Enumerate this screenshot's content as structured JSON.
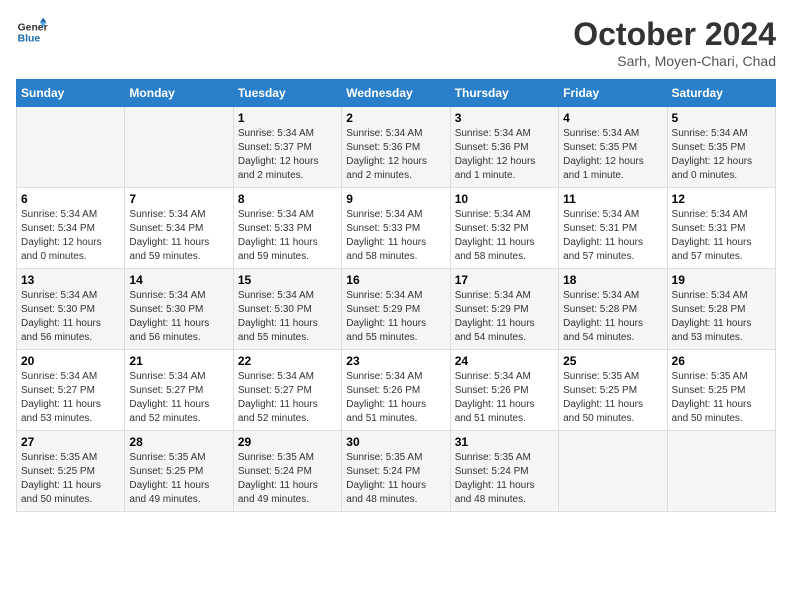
{
  "logo": {
    "line1": "General",
    "line2": "Blue"
  },
  "title": "October 2024",
  "location": "Sarh, Moyen-Chari, Chad",
  "headers": [
    "Sunday",
    "Monday",
    "Tuesday",
    "Wednesday",
    "Thursday",
    "Friday",
    "Saturday"
  ],
  "weeks": [
    [
      {
        "day": "",
        "info": ""
      },
      {
        "day": "",
        "info": ""
      },
      {
        "day": "1",
        "info": "Sunrise: 5:34 AM\nSunset: 5:37 PM\nDaylight: 12 hours\nand 2 minutes."
      },
      {
        "day": "2",
        "info": "Sunrise: 5:34 AM\nSunset: 5:36 PM\nDaylight: 12 hours\nand 2 minutes."
      },
      {
        "day": "3",
        "info": "Sunrise: 5:34 AM\nSunset: 5:36 PM\nDaylight: 12 hours\nand 1 minute."
      },
      {
        "day": "4",
        "info": "Sunrise: 5:34 AM\nSunset: 5:35 PM\nDaylight: 12 hours\nand 1 minute."
      },
      {
        "day": "5",
        "info": "Sunrise: 5:34 AM\nSunset: 5:35 PM\nDaylight: 12 hours\nand 0 minutes."
      }
    ],
    [
      {
        "day": "6",
        "info": "Sunrise: 5:34 AM\nSunset: 5:34 PM\nDaylight: 12 hours\nand 0 minutes."
      },
      {
        "day": "7",
        "info": "Sunrise: 5:34 AM\nSunset: 5:34 PM\nDaylight: 11 hours\nand 59 minutes."
      },
      {
        "day": "8",
        "info": "Sunrise: 5:34 AM\nSunset: 5:33 PM\nDaylight: 11 hours\nand 59 minutes."
      },
      {
        "day": "9",
        "info": "Sunrise: 5:34 AM\nSunset: 5:33 PM\nDaylight: 11 hours\nand 58 minutes."
      },
      {
        "day": "10",
        "info": "Sunrise: 5:34 AM\nSunset: 5:32 PM\nDaylight: 11 hours\nand 58 minutes."
      },
      {
        "day": "11",
        "info": "Sunrise: 5:34 AM\nSunset: 5:31 PM\nDaylight: 11 hours\nand 57 minutes."
      },
      {
        "day": "12",
        "info": "Sunrise: 5:34 AM\nSunset: 5:31 PM\nDaylight: 11 hours\nand 57 minutes."
      }
    ],
    [
      {
        "day": "13",
        "info": "Sunrise: 5:34 AM\nSunset: 5:30 PM\nDaylight: 11 hours\nand 56 minutes."
      },
      {
        "day": "14",
        "info": "Sunrise: 5:34 AM\nSunset: 5:30 PM\nDaylight: 11 hours\nand 56 minutes."
      },
      {
        "day": "15",
        "info": "Sunrise: 5:34 AM\nSunset: 5:30 PM\nDaylight: 11 hours\nand 55 minutes."
      },
      {
        "day": "16",
        "info": "Sunrise: 5:34 AM\nSunset: 5:29 PM\nDaylight: 11 hours\nand 55 minutes."
      },
      {
        "day": "17",
        "info": "Sunrise: 5:34 AM\nSunset: 5:29 PM\nDaylight: 11 hours\nand 54 minutes."
      },
      {
        "day": "18",
        "info": "Sunrise: 5:34 AM\nSunset: 5:28 PM\nDaylight: 11 hours\nand 54 minutes."
      },
      {
        "day": "19",
        "info": "Sunrise: 5:34 AM\nSunset: 5:28 PM\nDaylight: 11 hours\nand 53 minutes."
      }
    ],
    [
      {
        "day": "20",
        "info": "Sunrise: 5:34 AM\nSunset: 5:27 PM\nDaylight: 11 hours\nand 53 minutes."
      },
      {
        "day": "21",
        "info": "Sunrise: 5:34 AM\nSunset: 5:27 PM\nDaylight: 11 hours\nand 52 minutes."
      },
      {
        "day": "22",
        "info": "Sunrise: 5:34 AM\nSunset: 5:27 PM\nDaylight: 11 hours\nand 52 minutes."
      },
      {
        "day": "23",
        "info": "Sunrise: 5:34 AM\nSunset: 5:26 PM\nDaylight: 11 hours\nand 51 minutes."
      },
      {
        "day": "24",
        "info": "Sunrise: 5:34 AM\nSunset: 5:26 PM\nDaylight: 11 hours\nand 51 minutes."
      },
      {
        "day": "25",
        "info": "Sunrise: 5:35 AM\nSunset: 5:25 PM\nDaylight: 11 hours\nand 50 minutes."
      },
      {
        "day": "26",
        "info": "Sunrise: 5:35 AM\nSunset: 5:25 PM\nDaylight: 11 hours\nand 50 minutes."
      }
    ],
    [
      {
        "day": "27",
        "info": "Sunrise: 5:35 AM\nSunset: 5:25 PM\nDaylight: 11 hours\nand 50 minutes."
      },
      {
        "day": "28",
        "info": "Sunrise: 5:35 AM\nSunset: 5:25 PM\nDaylight: 11 hours\nand 49 minutes."
      },
      {
        "day": "29",
        "info": "Sunrise: 5:35 AM\nSunset: 5:24 PM\nDaylight: 11 hours\nand 49 minutes."
      },
      {
        "day": "30",
        "info": "Sunrise: 5:35 AM\nSunset: 5:24 PM\nDaylight: 11 hours\nand 48 minutes."
      },
      {
        "day": "31",
        "info": "Sunrise: 5:35 AM\nSunset: 5:24 PM\nDaylight: 11 hours\nand 48 minutes."
      },
      {
        "day": "",
        "info": ""
      },
      {
        "day": "",
        "info": ""
      }
    ]
  ]
}
